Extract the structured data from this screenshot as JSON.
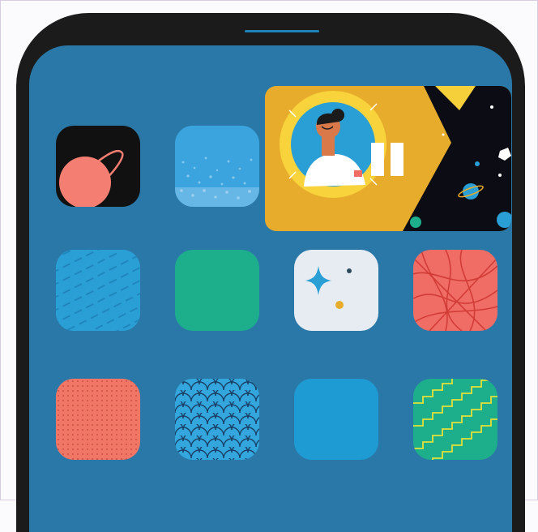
{
  "screen": {
    "background": "#2a78a8",
    "frame_color": "#1b1b1b",
    "speaker_color": "#1e83b8"
  },
  "home_screen": {
    "rows": [
      [
        {
          "name": "planet-app-icon",
          "icon": "planet-icon",
          "color": "#111111"
        },
        {
          "name": "speckled-blue-app-icon",
          "icon": "speckle-pattern-icon",
          "color": "#3ba3de"
        }
      ],
      [
        {
          "name": "striped-blue-app-icon",
          "icon": "diagonal-stripes-icon",
          "color": "#2a9fd6"
        },
        {
          "name": "green-app-icon",
          "icon": "blank-icon",
          "color": "#1dae8c"
        },
        {
          "name": "sparkle-app-icon",
          "icon": "sparkle-icon",
          "color": "#e6ecf2"
        },
        {
          "name": "red-scribble-app-icon",
          "icon": "scribble-icon",
          "color": "#f06d66"
        }
      ],
      [
        {
          "name": "dotted-coral-app-icon",
          "icon": "dot-pattern-icon",
          "color": "#f07666"
        },
        {
          "name": "scales-blue-app-icon",
          "icon": "scale-pattern-icon",
          "color": "#33a7dd"
        },
        {
          "name": "plain-blue-app-icon",
          "icon": "blank-icon",
          "color": "#1f9bd4"
        },
        {
          "name": "zigzag-green-app-icon",
          "icon": "zigzag-icon",
          "color": "#1dae8c"
        }
      ]
    ]
  },
  "pip_window": {
    "content": "astronaut-in-porthole-illustration",
    "state": "paused",
    "control": "pause-icon",
    "colors": {
      "panel": "#e8ac2c",
      "ring": "#f8d33b",
      "space": "#0c0c14"
    }
  }
}
